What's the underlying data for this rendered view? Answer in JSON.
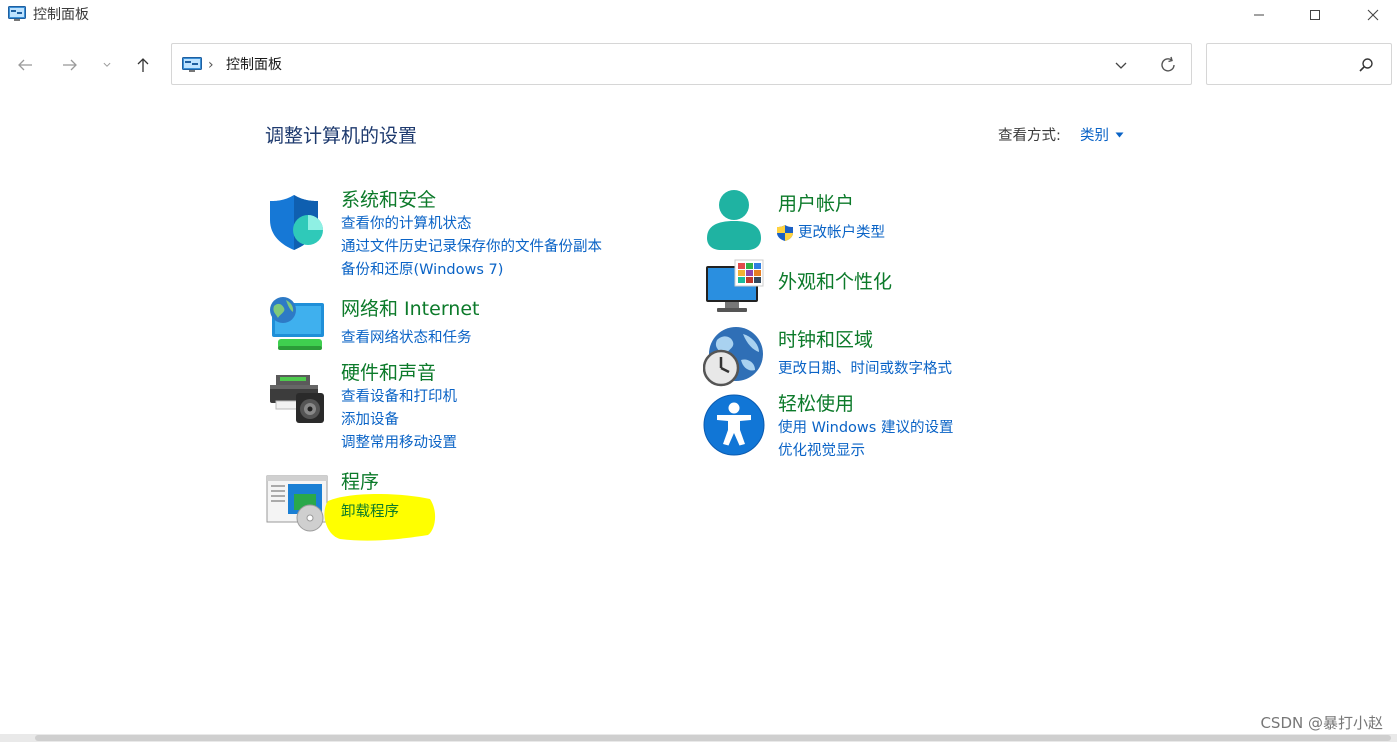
{
  "window": {
    "title": "控制面板"
  },
  "addressbar": {
    "separator": "›",
    "path": "控制面板"
  },
  "search": {
    "placeholder": ""
  },
  "header": {
    "title": "调整计算机的设置",
    "view_by_label": "查看方式:",
    "view_by_value": "类别"
  },
  "categories": {
    "system": {
      "icon": "security-shield-icon",
      "title": "系统和安全",
      "links": [
        "查看你的计算机状态",
        "通过文件历史记录保存你的文件备份副本",
        "备份和还原(Windows 7)"
      ]
    },
    "network": {
      "icon": "network-globe-icon",
      "title": "网络和 Internet",
      "links": [
        "查看网络状态和任务"
      ]
    },
    "hardware": {
      "icon": "printer-speaker-icon",
      "title": "硬件和声音",
      "links": [
        "查看设备和打印机",
        "添加设备",
        "调整常用移动设置"
      ]
    },
    "programs": {
      "icon": "programs-icon",
      "title": "程序",
      "links": [
        "卸载程序"
      ]
    },
    "users": {
      "icon": "user-account-icon",
      "title": "用户帐户",
      "links": [
        "更改帐户类型"
      ]
    },
    "appearance": {
      "icon": "appearance-monitor-icon",
      "title": "外观和个性化",
      "links": []
    },
    "clock": {
      "icon": "clock-globe-icon",
      "title": "时钟和区域",
      "links": [
        "更改日期、时间或数字格式"
      ]
    },
    "ease": {
      "icon": "accessibility-icon",
      "title": "轻松使用",
      "links": [
        "使用 Windows 建议的设置",
        "优化视觉显示"
      ]
    }
  },
  "colors": {
    "category_title": "#0c7a2a",
    "link": "#0a63c6",
    "page_title": "#1e3a6e",
    "highlight": "#ffff00"
  },
  "watermark": "CSDN @暴打小赵"
}
